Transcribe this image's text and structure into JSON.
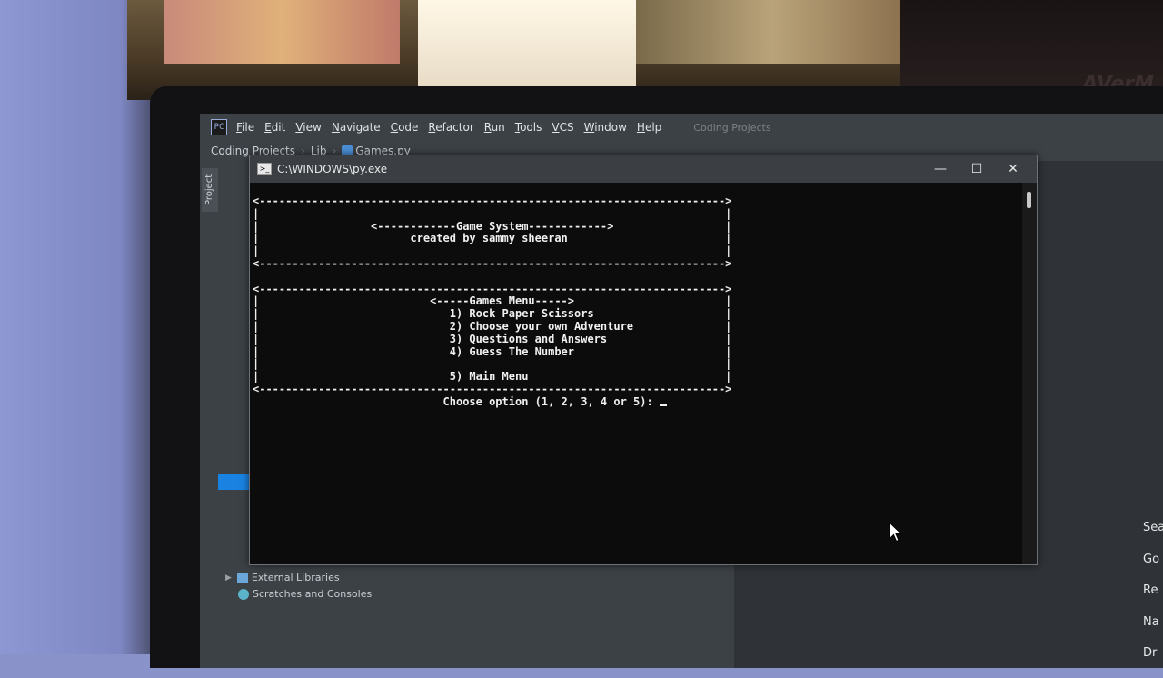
{
  "background": {
    "webcam_brand": "AVerM"
  },
  "ide": {
    "menu": [
      {
        "accel": "F",
        "rest": "ile"
      },
      {
        "accel": "E",
        "rest": "dit"
      },
      {
        "accel": "V",
        "rest": "iew"
      },
      {
        "accel": "N",
        "rest": "avigate"
      },
      {
        "accel": "C",
        "rest": "ode"
      },
      {
        "accel": "R",
        "rest": "efactor"
      },
      {
        "accel": "R",
        "rest": "un"
      },
      {
        "accel": "T",
        "rest": "ools"
      },
      {
        "accel": "V",
        "rest": "CS"
      },
      {
        "accel": "W",
        "rest": "indow"
      },
      {
        "accel": "H",
        "rest": "elp"
      }
    ],
    "project_title": "Coding Projects",
    "breadcrumb": [
      "Coding Projects",
      "Lib",
      "Games.py"
    ],
    "sidebar_tab": "Project",
    "tree": {
      "external_libraries": "External Libraries",
      "scratches": "Scratches and Consoles"
    },
    "right_partial": [
      "Sea",
      "Go",
      "Re",
      "Na",
      "Dr"
    ]
  },
  "console": {
    "title": "C:\\WINDOWS\\py.exe",
    "buttons": {
      "minimize": "—",
      "maximize": "☐",
      "close": "✕"
    },
    "lines": [
      "<----------------------------------------------------------------------->",
      "|                                                                       |",
      "|                 <------------Game System------------>                 |",
      "|                       created by sammy sheeran                        |",
      "|                                                                       |",
      "<----------------------------------------------------------------------->",
      "",
      "<----------------------------------------------------------------------->",
      "|                          <-----Games Menu----->                       |",
      "|                             1) Rock Paper Scissors                    |",
      "|                             2) Choose your own Adventure              |",
      "|                             3) Questions and Answers                  |",
      "|                             4) Guess The Number                       |",
      "|                                                                       |",
      "|                             5) Main Menu                              |",
      "<----------------------------------------------------------------------->"
    ],
    "prompt": "                             Choose option (1, 2, 3, 4 or 5): "
  }
}
